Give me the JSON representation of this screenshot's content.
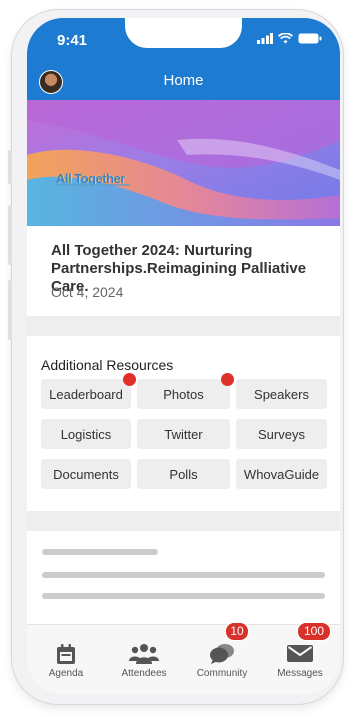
{
  "status_bar": {
    "time": "9:41"
  },
  "header": {
    "title": "Home"
  },
  "banner": {
    "logo_text": "All Together"
  },
  "event": {
    "title": "All Together 2024: Nurturing Partnerships.Reimagining Palliative Care.",
    "date": "Oct 4, 2024"
  },
  "resources": {
    "title": "Additional Resources",
    "items": [
      {
        "label": "Leaderboard",
        "has_notification": true
      },
      {
        "label": "Photos",
        "has_notification": true
      },
      {
        "label": "Speakers",
        "has_notification": false
      },
      {
        "label": "Logistics",
        "has_notification": false
      },
      {
        "label": "Twitter",
        "has_notification": false
      },
      {
        "label": "Surveys",
        "has_notification": false
      },
      {
        "label": "Documents",
        "has_notification": false
      },
      {
        "label": "Polls",
        "has_notification": false
      },
      {
        "label": "WhovaGuide",
        "has_notification": false
      }
    ]
  },
  "tabbar": {
    "items": [
      {
        "label": "Agenda",
        "icon": "calendar-icon"
      },
      {
        "label": "Attendees",
        "icon": "people-icon"
      },
      {
        "label": "Community",
        "icon": "chat-bubbles-icon",
        "badge": "10"
      },
      {
        "label": "Messages",
        "icon": "envelope-icon",
        "badge": "100"
      }
    ]
  },
  "colors": {
    "header_blue": "#1e7bd2",
    "notification_red": "#e0302a",
    "icon_gray": "#555555"
  }
}
